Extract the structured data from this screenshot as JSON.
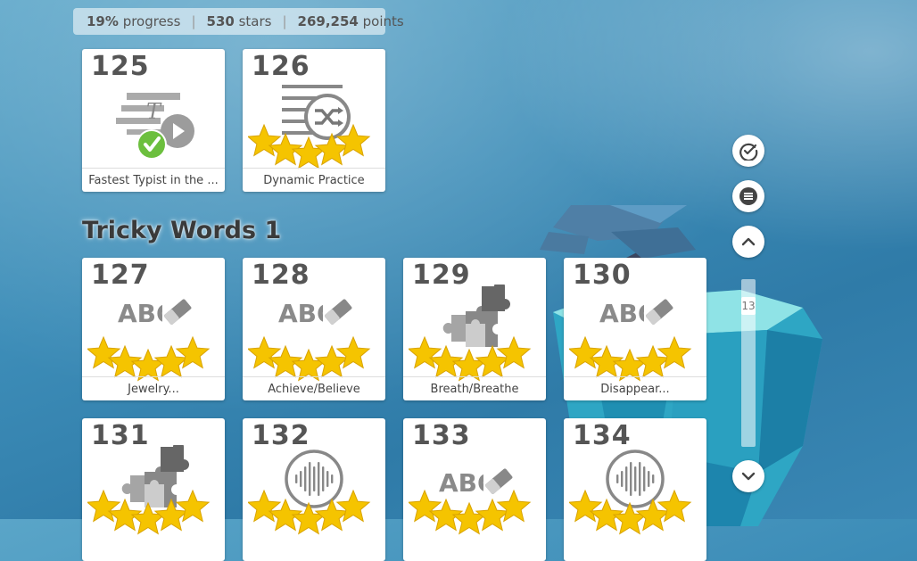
{
  "stats": {
    "progress_value": "19%",
    "progress_label": "progress",
    "stars_value": "530",
    "stars_label": "stars",
    "points_value": "269,254",
    "points_label": "points",
    "separator": "|"
  },
  "top_cards": [
    {
      "number": "125",
      "label": "Fastest Typist in the ...",
      "icon": "typing-speed-icon",
      "completed": true
    },
    {
      "number": "126",
      "label": "Dynamic Practice",
      "icon": "shuffle-practice-icon",
      "stars": 5
    }
  ],
  "section": {
    "title": "Tricky Words 1"
  },
  "cards": [
    {
      "number": "127",
      "label": "Jewelry...",
      "icon": "abc-eraser-icon",
      "stars": 5
    },
    {
      "number": "128",
      "label": "Achieve/Believe",
      "icon": "abc-eraser-icon",
      "stars": 5
    },
    {
      "number": "129",
      "label": "Breath/Breathe",
      "icon": "puzzle-icon",
      "stars": 5
    },
    {
      "number": "130",
      "label": "Disappear...",
      "icon": "abc-eraser-icon",
      "stars": 5
    },
    {
      "number": "131",
      "label": "",
      "icon": "puzzle-icon",
      "stars": 5
    },
    {
      "number": "132",
      "label": "",
      "icon": "audio-wave-icon",
      "stars": 5
    },
    {
      "number": "133",
      "label": "",
      "icon": "abc-eraser-icon",
      "stars": 5
    },
    {
      "number": "134",
      "label": "",
      "icon": "audio-wave-icon",
      "stars": 5
    }
  ],
  "side_nav": {
    "buttons": [
      "check-circle-icon",
      "list-menu-icon",
      "chevron-up-icon",
      "chevron-down-icon"
    ],
    "scroll_indicator": "13"
  },
  "colors": {
    "star": "#f5c400",
    "star_edge": "#d9a300",
    "check": "#6cbf3e",
    "icon_gray": "#999999"
  }
}
